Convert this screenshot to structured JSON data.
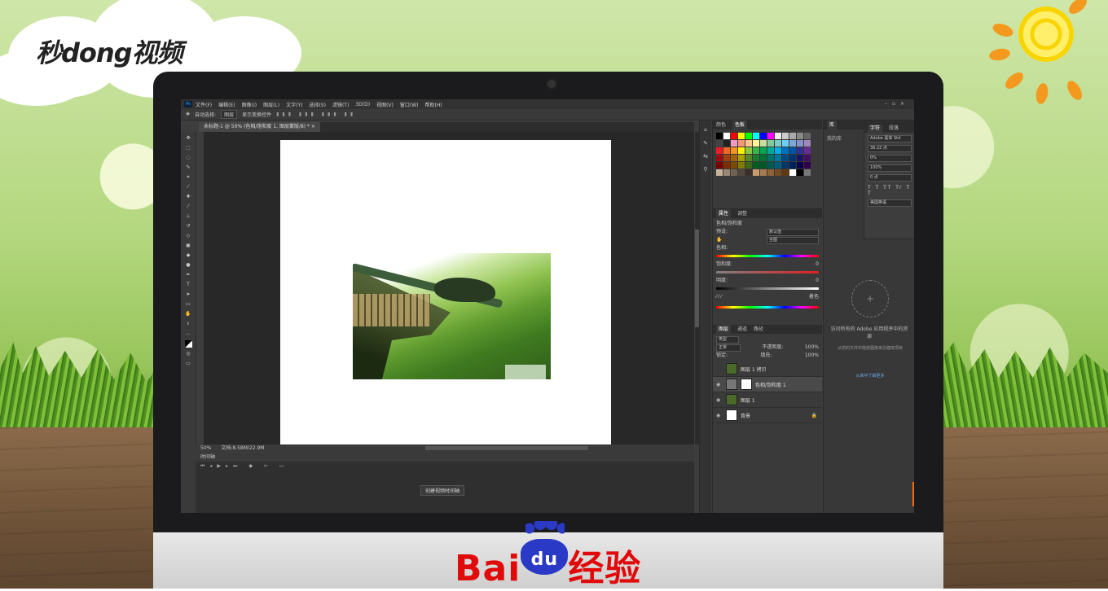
{
  "watermark": {
    "brand": "秒dong视频",
    "footer_logo": "Bai",
    "footer_paw": "du",
    "footer_text": "经验"
  },
  "colors": {
    "accent": "#31a8ff",
    "baidu_red": "#e10a0a",
    "baidu_blue": "#2a39c6"
  },
  "menu": [
    "文件(F)",
    "编辑(E)",
    "图像(I)",
    "图层(L)",
    "文字(Y)",
    "选择(S)",
    "滤镜(T)",
    "3D(D)",
    "视图(V)",
    "窗口(W)",
    "帮助(H)"
  ],
  "options": {
    "auto_select": "自动选择:",
    "auto_select_value": "图层",
    "transform": "显示变换控件"
  },
  "document_tab": "未标题-1 @ 50% (色相/饱和度 1, 图层蒙版/8) * ×",
  "status": {
    "zoom": "50%",
    "doc_size": "文档:8.58M/22.9M"
  },
  "timeline": {
    "title": "时间轴",
    "create_button": "创建视频时间轴"
  },
  "panels": {
    "swatches_tabs": [
      "颜色",
      "色板"
    ],
    "props_tabs": [
      "属性",
      "调整"
    ],
    "hue_sat_title": "色相/饱和度",
    "preset_label": "预设:",
    "preset_value": "默认值",
    "channel_value": "全图",
    "hue_label": "色相:",
    "sat_label": "饱和度:",
    "sat_value": "0",
    "light_label": "明度:",
    "light_value": "0",
    "colorize_label": "着色",
    "layers_tabs": [
      "图层",
      "通道",
      "路径"
    ],
    "kind_label": "类型",
    "blend_mode": "正常",
    "opacity_label": "不透明度:",
    "opacity_value": "100%",
    "lock_label": "锁定:",
    "fill_label": "填充:",
    "fill_value": "100%",
    "layers": [
      {
        "name": "图层 1 拷贝",
        "visible": false
      },
      {
        "name": "色相/饱和度 1",
        "visible": true
      },
      {
        "name": "图层 1",
        "visible": true
      },
      {
        "name": "背景",
        "visible": true
      }
    ]
  },
  "learn": {
    "tab": "库",
    "tab2": "我的库",
    "message": "访问所有的 Adobe 应用程序中的资源",
    "sub": "从您的文件中拖放图像来创建库项目",
    "link": "从库中了解更多"
  },
  "character": {
    "tabs": [
      "字符",
      "段落"
    ],
    "font": "Adobe 黑体 Std",
    "size": "36.22 点",
    "tracking": "0%",
    "scale": "100%",
    "baseline": "0 点",
    "language": "美国英语"
  }
}
